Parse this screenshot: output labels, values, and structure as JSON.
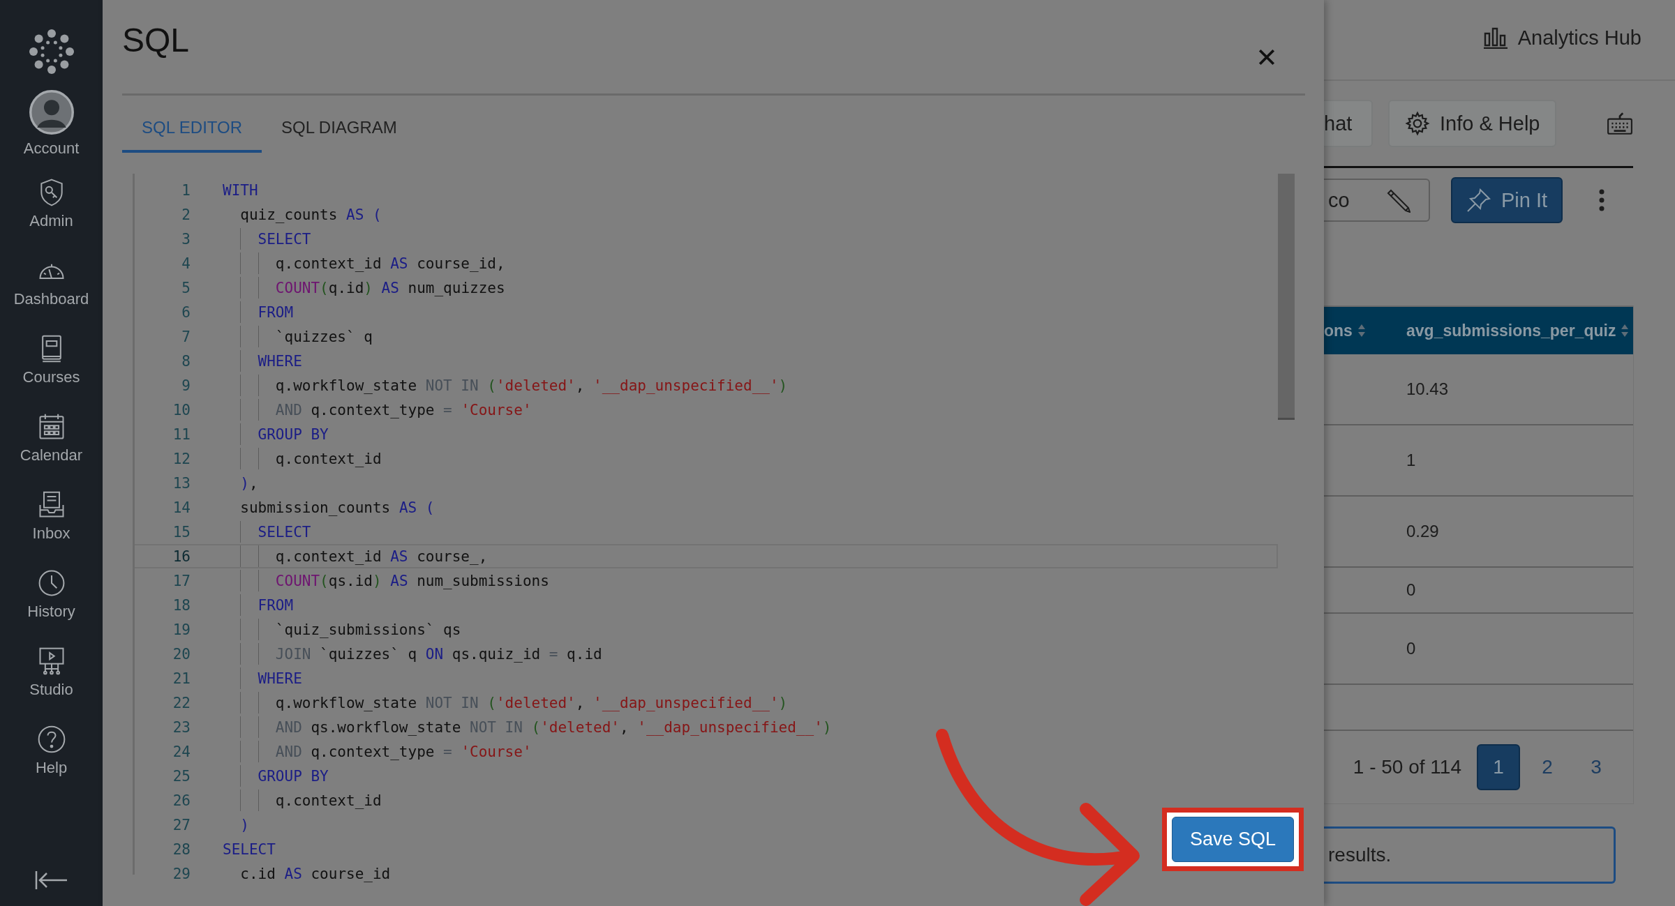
{
  "sidebar": {
    "items": [
      {
        "kind": "account",
        "label": "Account"
      },
      {
        "kind": "admin",
        "label": "Admin"
      },
      {
        "kind": "dashboard",
        "label": "Dashboard"
      },
      {
        "kind": "courses",
        "label": "Courses"
      },
      {
        "kind": "calendar",
        "label": "Calendar"
      },
      {
        "kind": "inbox",
        "label": "Inbox"
      },
      {
        "kind": "history",
        "label": "History"
      },
      {
        "kind": "studio",
        "label": "Studio"
      },
      {
        "kind": "help",
        "label": "Help"
      }
    ]
  },
  "modal": {
    "title": "SQL",
    "tabs": [
      {
        "label": "SQL EDITOR",
        "selected": true
      },
      {
        "label": "SQL DIAGRAM",
        "selected": false
      }
    ],
    "editor": {
      "lines": [
        {
          "number": "1",
          "active": false,
          "tokens": [
            {
              "kind": "keyword",
              "text": "WITH"
            }
          ]
        },
        {
          "number": "2",
          "active": false,
          "tokens": [
            {
              "kind": "plain",
              "text": "  quiz_counts "
            },
            {
              "kind": "keyword",
              "text": "AS "
            },
            {
              "kind": "bracket",
              "text": "("
            }
          ]
        },
        {
          "number": "3",
          "active": false,
          "tokens": [
            {
              "kind": "keyword",
              "text": "    SELECT"
            }
          ]
        },
        {
          "number": "4",
          "active": false,
          "tokens": [
            {
              "kind": "plain",
              "text": "      q.context_id "
            },
            {
              "kind": "keyword",
              "text": "AS "
            },
            {
              "kind": "plain",
              "text": "course_id,"
            }
          ]
        },
        {
          "number": "5",
          "active": false,
          "tokens": [
            {
              "kind": "function",
              "text": "      COUNT"
            },
            {
              "kind": "paren",
              "text": "("
            },
            {
              "kind": "plain",
              "text": "q.id"
            },
            {
              "kind": "paren",
              "text": ")"
            },
            {
              "kind": "keyword",
              "text": " AS "
            },
            {
              "kind": "plain",
              "text": "num_quizzes"
            }
          ]
        },
        {
          "number": "6",
          "active": false,
          "tokens": [
            {
              "kind": "keyword",
              "text": "    FROM"
            }
          ]
        },
        {
          "number": "7",
          "active": false,
          "tokens": [
            {
              "kind": "plain",
              "text": "      `quizzes` q"
            }
          ]
        },
        {
          "number": "8",
          "active": false,
          "tokens": [
            {
              "kind": "keyword",
              "text": "    WHERE"
            }
          ]
        },
        {
          "number": "9",
          "active": false,
          "tokens": [
            {
              "kind": "plain",
              "text": "      q.workflow_state "
            },
            {
              "kind": "operator",
              "text": "NOT IN "
            },
            {
              "kind": "paren",
              "text": "("
            },
            {
              "kind": "string",
              "text": "'deleted'"
            },
            {
              "kind": "plain",
              "text": ", "
            },
            {
              "kind": "string",
              "text": "'__dap_unspecified__'"
            },
            {
              "kind": "paren",
              "text": ")"
            }
          ]
        },
        {
          "number": "10",
          "active": false,
          "tokens": [
            {
              "kind": "operator",
              "text": "      AND "
            },
            {
              "kind": "plain",
              "text": "q.context_type "
            },
            {
              "kind": "operator",
              "text": "= "
            },
            {
              "kind": "string",
              "text": "'Course'"
            }
          ]
        },
        {
          "number": "11",
          "active": false,
          "tokens": [
            {
              "kind": "keyword",
              "text": "    GROUP BY"
            }
          ]
        },
        {
          "number": "12",
          "active": false,
          "tokens": [
            {
              "kind": "plain",
              "text": "      q.context_id"
            }
          ]
        },
        {
          "number": "13",
          "active": false,
          "tokens": [
            {
              "kind": "bracket",
              "text": "  )"
            },
            {
              "kind": "plain",
              "text": ","
            }
          ]
        },
        {
          "number": "14",
          "active": false,
          "tokens": [
            {
              "kind": "plain",
              "text": "  submission_counts "
            },
            {
              "kind": "keyword",
              "text": "AS "
            },
            {
              "kind": "bracket",
              "text": "("
            }
          ]
        },
        {
          "number": "15",
          "active": false,
          "tokens": [
            {
              "kind": "keyword",
              "text": "    SELECT"
            }
          ]
        },
        {
          "number": "16",
          "active": true,
          "tokens": [
            {
              "kind": "plain",
              "text": "      q.context_id "
            },
            {
              "kind": "keyword",
              "text": "AS "
            },
            {
              "kind": "plain",
              "text": "course_,"
            }
          ]
        },
        {
          "number": "17",
          "active": false,
          "tokens": [
            {
              "kind": "function",
              "text": "      COUNT"
            },
            {
              "kind": "paren",
              "text": "("
            },
            {
              "kind": "plain",
              "text": "qs.id"
            },
            {
              "kind": "paren",
              "text": ")"
            },
            {
              "kind": "keyword",
              "text": " AS "
            },
            {
              "kind": "plain",
              "text": "num_submissions"
            }
          ]
        },
        {
          "number": "18",
          "active": false,
          "tokens": [
            {
              "kind": "keyword",
              "text": "    FROM"
            }
          ]
        },
        {
          "number": "19",
          "active": false,
          "tokens": [
            {
              "kind": "plain",
              "text": "      `quiz_submissions` qs"
            }
          ]
        },
        {
          "number": "20",
          "active": false,
          "tokens": [
            {
              "kind": "operator",
              "text": "      JOIN "
            },
            {
              "kind": "plain",
              "text": "`quizzes` q "
            },
            {
              "kind": "keyword",
              "text": "ON "
            },
            {
              "kind": "plain",
              "text": "qs.quiz_id "
            },
            {
              "kind": "operator",
              "text": "= "
            },
            {
              "kind": "plain",
              "text": "q.id"
            }
          ]
        },
        {
          "number": "21",
          "active": false,
          "tokens": [
            {
              "kind": "keyword",
              "text": "    WHERE"
            }
          ]
        },
        {
          "number": "22",
          "active": false,
          "tokens": [
            {
              "kind": "plain",
              "text": "      q.workflow_state "
            },
            {
              "kind": "operator",
              "text": "NOT IN "
            },
            {
              "kind": "paren",
              "text": "("
            },
            {
              "kind": "string",
              "text": "'deleted'"
            },
            {
              "kind": "plain",
              "text": ", "
            },
            {
              "kind": "string",
              "text": "'__dap_unspecified__'"
            },
            {
              "kind": "paren",
              "text": ")"
            }
          ]
        },
        {
          "number": "23",
          "active": false,
          "tokens": [
            {
              "kind": "operator",
              "text": "      AND "
            },
            {
              "kind": "plain",
              "text": "qs.workflow_state "
            },
            {
              "kind": "operator",
              "text": "NOT IN "
            },
            {
              "kind": "paren",
              "text": "("
            },
            {
              "kind": "string",
              "text": "'deleted'"
            },
            {
              "kind": "plain",
              "text": ", "
            },
            {
              "kind": "string",
              "text": "'__dap_unspecified__'"
            },
            {
              "kind": "paren",
              "text": ")"
            }
          ]
        },
        {
          "number": "24",
          "active": false,
          "tokens": [
            {
              "kind": "operator",
              "text": "      AND "
            },
            {
              "kind": "plain",
              "text": "q.context_type "
            },
            {
              "kind": "operator",
              "text": "= "
            },
            {
              "kind": "string",
              "text": "'Course'"
            }
          ]
        },
        {
          "number": "25",
          "active": false,
          "tokens": [
            {
              "kind": "keyword",
              "text": "    GROUP BY"
            }
          ]
        },
        {
          "number": "26",
          "active": false,
          "tokens": [
            {
              "kind": "plain",
              "text": "      q.context_id"
            }
          ]
        },
        {
          "number": "27",
          "active": false,
          "tokens": [
            {
              "kind": "bracket",
              "text": "  )"
            }
          ]
        },
        {
          "number": "28",
          "active": false,
          "tokens": [
            {
              "kind": "keyword",
              "text": "SELECT"
            }
          ]
        },
        {
          "number": "29",
          "active": false,
          "tokens": [
            {
              "kind": "plain",
              "text": "  c.id "
            },
            {
              "kind": "keyword",
              "text": "AS "
            },
            {
              "kind": "plain",
              "text": "course_id"
            }
          ]
        }
      ]
    },
    "save_button": {
      "label": "Save SQL",
      "highlighted": true
    }
  },
  "page": {
    "header_link": "Analytics Hub",
    "toolbar": {
      "chat_button": "hat",
      "info_button": "Info & Help"
    },
    "name_field": {
      "value": "co"
    },
    "pin_button": "Pin It",
    "table": {
      "columns": [
        "ons",
        "avg_submissions_per_quiz"
      ],
      "rows": [
        {
          "column_2": "10.43"
        },
        {
          "column_2": "1"
        },
        {
          "column_2": "0.29"
        },
        {
          "column_2": "0"
        },
        {
          "column_2": "0"
        },
        {}
      ]
    },
    "pagination": {
      "range": "1 - 50 of 114",
      "pages": [
        {
          "label": "1",
          "selected": true
        },
        {
          "label": "2",
          "selected": false
        },
        {
          "label": "3",
          "selected": false
        }
      ]
    },
    "message": "results."
  }
}
